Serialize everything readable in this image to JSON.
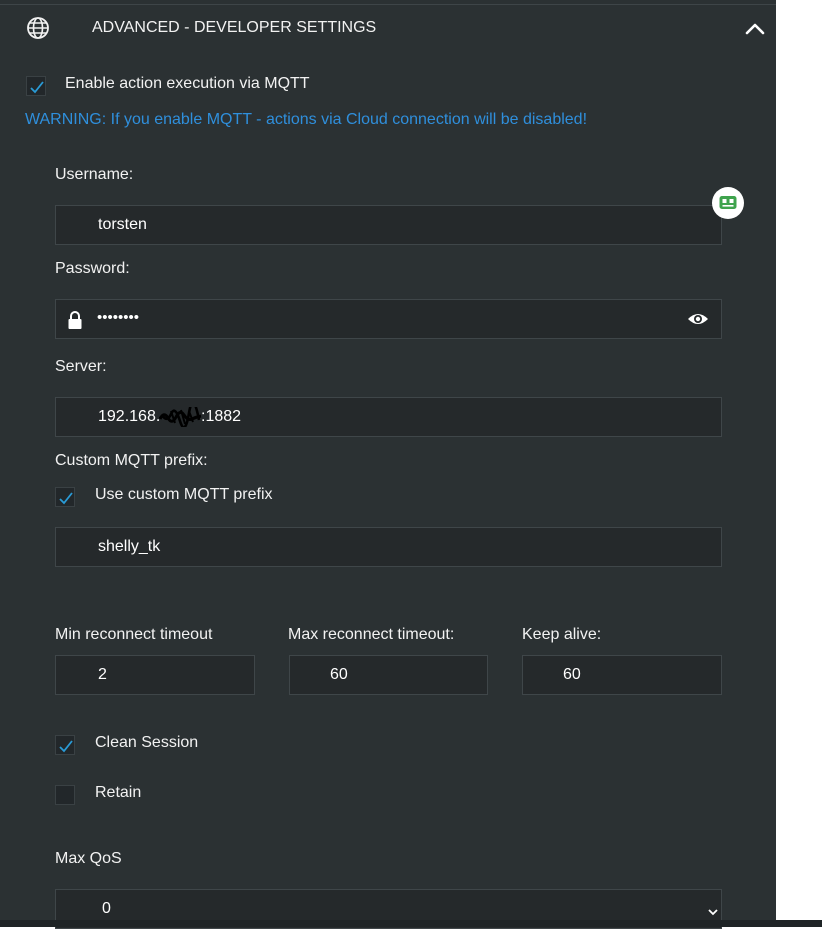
{
  "section": {
    "title": "ADVANCED - DEVELOPER SETTINGS"
  },
  "mqtt": {
    "enable_label": "Enable action execution via MQTT",
    "enable_checked": true,
    "warning": "WARNING: If you enable MQTT - actions via Cloud connection will be disabled!"
  },
  "username": {
    "label": "Username:",
    "value": "torsten"
  },
  "password": {
    "label": "Password:",
    "value": "••••••••"
  },
  "server": {
    "label": "Server:",
    "value_prefix": "192.168.",
    "value_suffix": ":1882"
  },
  "prefix": {
    "label": "Custom MQTT prefix:",
    "use_label": "Use custom MQTT prefix",
    "use_checked": true,
    "value": "shelly_tk"
  },
  "timeouts": {
    "min_label": "Min reconnect timeout",
    "min_value": "2",
    "max_label": "Max reconnect timeout:",
    "max_value": "60",
    "keepalive_label": "Keep alive:",
    "keepalive_value": "60"
  },
  "clean_session": {
    "label": "Clean Session",
    "checked": true
  },
  "retain": {
    "label": "Retain",
    "checked": false
  },
  "qos": {
    "label": "Max QoS",
    "value": "0"
  },
  "colors": {
    "panel_bg": "#2b3133",
    "field_bg": "#25292b",
    "accent_blue": "#2f8fdc",
    "check_blue": "#2a9bd6",
    "widget_green": "#3fa34d"
  }
}
